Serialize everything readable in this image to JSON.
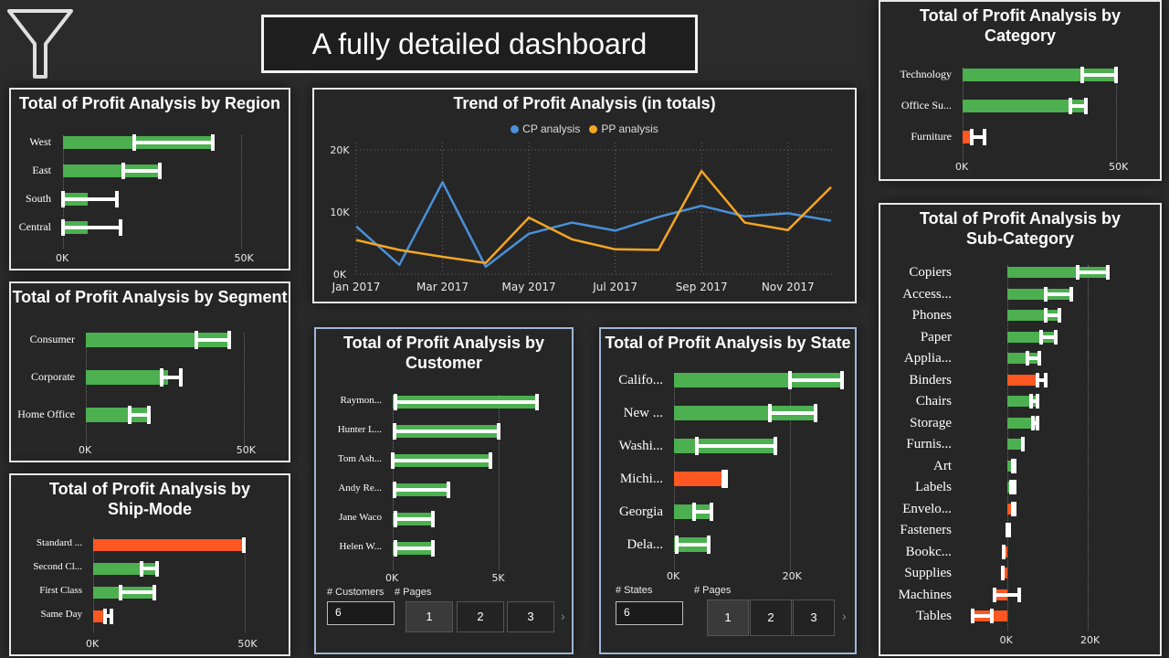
{
  "colors": {
    "positive": "#4caf50",
    "negative": "#ff5722",
    "cp_line": "#4a90d9",
    "pp_line": "#f5a623"
  },
  "header": {
    "title": "A fully detailed dashboard",
    "filter_icon": "funnel-icon"
  },
  "region": {
    "title": "Total of Profit Analysis by Region",
    "chart_data": {
      "type": "bar",
      "orientation": "horizontal",
      "categories": [
        "West",
        "East",
        "South",
        "Central"
      ],
      "values": [
        42000,
        27000,
        7000,
        7000
      ],
      "markers": [
        20000,
        17000,
        0,
        0
      ],
      "errors": [
        0,
        0,
        15000,
        16000
      ],
      "xlim": [
        0,
        55000
      ],
      "ticks": [
        "0K",
        "50K"
      ]
    }
  },
  "segment": {
    "title": "Total of Profit Analysis by Segment",
    "chart_data": {
      "type": "bar",
      "orientation": "horizontal",
      "categories": [
        "Consumer",
        "Corporate",
        "Home Office"
      ],
      "values": [
        45500,
        26000,
        20000
      ],
      "markers": [
        35000,
        24000,
        14000
      ],
      "errors": [
        0,
        30000,
        0
      ],
      "xlim": [
        0,
        55000
      ],
      "ticks": [
        "0K",
        "50K"
      ]
    }
  },
  "shipmode": {
    "title_lines": [
      "Total of Profit Analysis by",
      "Ship-Mode"
    ],
    "chart_data": {
      "type": "bar",
      "orientation": "horizontal",
      "categories": [
        "Standard ...",
        "Second Cl...",
        "First Class",
        "Same Day"
      ],
      "values": [
        49500,
        21000,
        20000,
        4000
      ],
      "markers": [
        49500,
        16000,
        9000,
        4000
      ],
      "errors": [
        0,
        0,
        20000,
        6000
      ],
      "negative": [
        true,
        false,
        false,
        true
      ],
      "xlim": [
        0,
        55000
      ],
      "ticks": [
        "0K",
        "50K"
      ]
    }
  },
  "trend": {
    "title": "Trend of Profit Analysis (in totals)",
    "chart_data": {
      "type": "line",
      "x": [
        "Jan 2017",
        "Feb 2017",
        "Mar 2017",
        "Apr 2017",
        "May 2017",
        "Jun 2017",
        "Jul 2017",
        "Aug 2017",
        "Sep 2017",
        "Oct 2017",
        "Nov 2017",
        "Dec 2017"
      ],
      "series": [
        {
          "name": "CP analysis",
          "values": [
            7700,
            1500,
            14800,
            1200,
            6500,
            8300,
            7000,
            9200,
            11000,
            9300,
            9800,
            8600
          ]
        },
        {
          "name": "PP analysis",
          "values": [
            5500,
            3900,
            2800,
            1800,
            9100,
            5600,
            4000,
            3900,
            16600,
            8300,
            7100,
            14000
          ]
        }
      ],
      "xticks": [
        "Jan 2017",
        "Mar 2017",
        "May 2017",
        "Jul 2017",
        "Sep 2017",
        "Nov 2017"
      ],
      "yticks": [
        "0K",
        "10K",
        "20K"
      ],
      "ylim": [
        0,
        20000
      ],
      "grid": true,
      "legend": "top-center"
    }
  },
  "customer": {
    "title_lines": [
      "Total of Profit Analysis by",
      "Customer"
    ],
    "chart_data": {
      "type": "bar",
      "orientation": "horizontal",
      "categories": [
        "Raymon...",
        "Hunter L...",
        "Tom Ash...",
        "Andy Re...",
        "Jane Waco",
        "Helen W..."
      ],
      "values": [
        6800,
        5000,
        4600,
        2600,
        1900,
        1900
      ],
      "markers": [
        150,
        100,
        0,
        100,
        150,
        150
      ],
      "errors": [
        0,
        0,
        0,
        0,
        0,
        0
      ],
      "xlim": [
        0,
        7300
      ],
      "ticks": [
        "0K",
        "5K"
      ]
    },
    "pager": {
      "count_label": "# Customers",
      "pages_label": "# Pages",
      "count_value": "6",
      "pages": [
        "1",
        "2",
        "3"
      ],
      "active": "1"
    }
  },
  "state": {
    "title": "Total of Profit Analysis by State",
    "chart_data": {
      "type": "bar",
      "orientation": "horizontal",
      "categories": [
        "Califo...",
        "New ...",
        "Washi...",
        "Michi...",
        "Georgia",
        "Dela..."
      ],
      "values": [
        29000,
        24500,
        17500,
        9000,
        6500,
        6000
      ],
      "markers": [
        20000,
        16500,
        4000,
        8500,
        3500,
        500
      ],
      "errors": [
        0,
        0,
        0,
        0,
        0,
        0
      ],
      "negative": [
        false,
        false,
        false,
        true,
        false,
        false
      ],
      "xlim": [
        0,
        30000
      ],
      "ticks": [
        "0K",
        "20K"
      ]
    },
    "pager": {
      "count_label": "# States",
      "pages_label": "# Pages",
      "count_value": "6",
      "pages": [
        "1",
        "2",
        "3"
      ],
      "active": "1"
    }
  },
  "category": {
    "title_lines": [
      "Total of Profit Analysis by",
      "Category"
    ],
    "chart_data": {
      "type": "bar",
      "orientation": "horizontal",
      "categories": [
        "Technology",
        "Office Su...",
        "Furniture"
      ],
      "values": [
        50000,
        40000,
        3000
      ],
      "markers": [
        39000,
        35000,
        3000
      ],
      "errors": [
        0,
        0,
        7000
      ],
      "negative": [
        false,
        false,
        true
      ],
      "xlim": [
        0,
        55000
      ],
      "ticks": [
        "0K",
        "50K"
      ]
    }
  },
  "subcategory": {
    "title_lines": [
      "Total of Profit Analysis by",
      "Sub-Category"
    ],
    "chart_data": {
      "type": "bar",
      "orientation": "horizontal",
      "categories": [
        "Copiers",
        "Access...",
        "Phones",
        "Paper",
        "Applia...",
        "Binders",
        "Chairs",
        "Storage",
        "Furnis...",
        "Art",
        "Labels",
        "Envelo...",
        "Fasteners",
        "Bookc...",
        "Supplies",
        "Machines",
        "Tables"
      ],
      "values": [
        25000,
        16000,
        13000,
        12000,
        8000,
        7500,
        7500,
        7500,
        4000,
        2000,
        1800,
        1500,
        600,
        -800,
        -1000,
        -3000,
        -8500
      ],
      "markers": [
        17500,
        9500,
        9500,
        8500,
        5000,
        7500,
        6000,
        6500,
        4000,
        1500,
        1000,
        1500,
        200,
        -800,
        -1000,
        -3000,
        -3800
      ],
      "errors": [
        0,
        0,
        0,
        0,
        0,
        9500,
        0,
        0,
        0,
        0,
        0,
        2000,
        0,
        0,
        0,
        3000,
        0
      ],
      "negative": [
        false,
        false,
        false,
        false,
        false,
        true,
        false,
        false,
        false,
        false,
        false,
        true,
        false,
        true,
        true,
        true,
        true
      ],
      "xlim": [
        -11000,
        32000
      ],
      "ticks": [
        "0K",
        "20K"
      ]
    }
  }
}
